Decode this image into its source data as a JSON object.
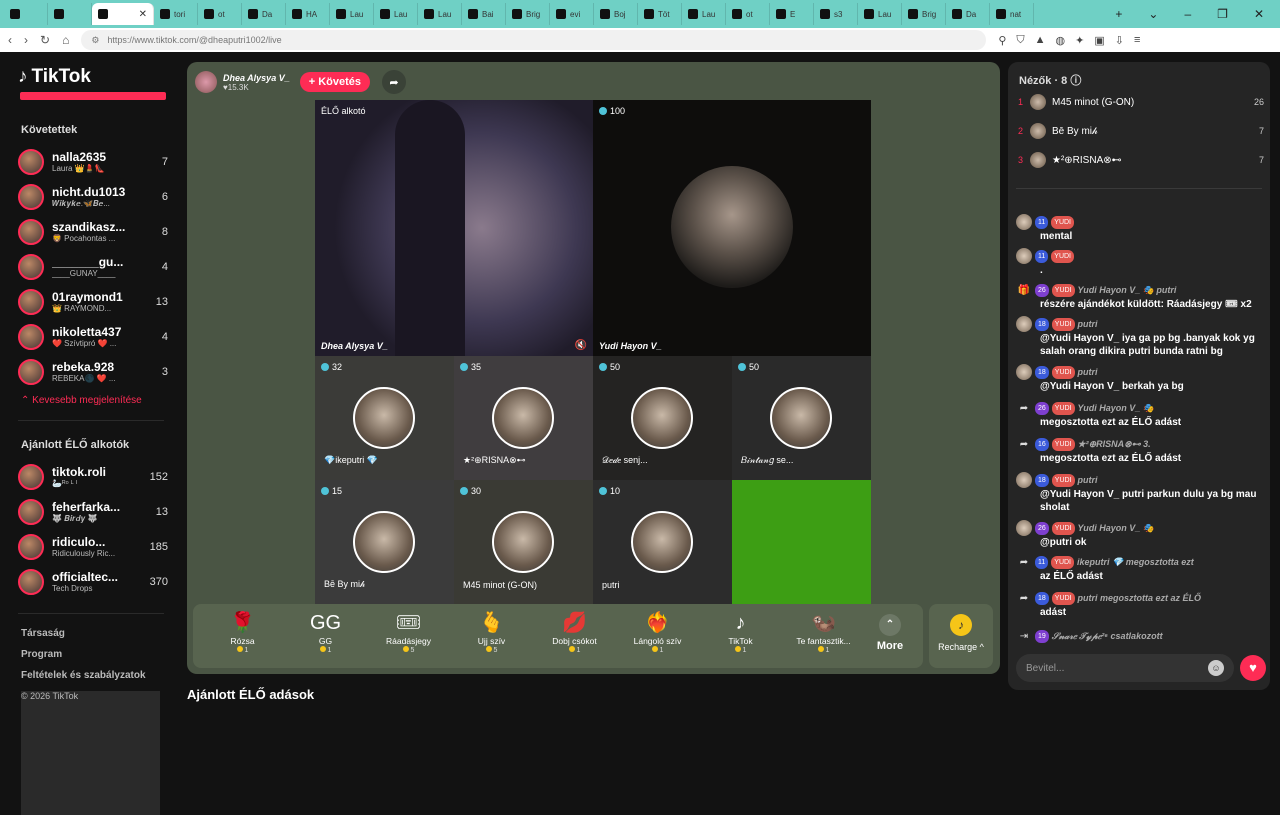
{
  "tabs": [
    "tori",
    "ot",
    "Da",
    "HA",
    "Lau",
    "Lau",
    "Lau",
    "Bai",
    "Brig",
    "evi",
    "Boj",
    "Töt",
    "Lau",
    "ot",
    "E",
    "s3",
    "Lau",
    "Brig",
    "Da",
    "nat"
  ],
  "browser": {
    "url": "https://www.tiktok.com/@dheaputri1002/live"
  },
  "sidebar": {
    "logo": "TikTok",
    "following_title": "Követettek",
    "following": [
      {
        "name": "nalla2635",
        "sub": "Laura 👑💄👠",
        "count": "7"
      },
      {
        "name": "nicht.du1013",
        "sub": "𝑾𝒊𝒌𝒚𝒌𝒆.🦋𝑩𝒆...",
        "count": "6"
      },
      {
        "name": "szandikasz...",
        "sub": "🦁 Pocahontas ...",
        "count": "8"
      },
      {
        "name": "_______gu...",
        "sub": "____GUNAY____",
        "count": "4"
      },
      {
        "name": "01raymond1",
        "sub": "👑 RAYMOND...",
        "count": "13"
      },
      {
        "name": "nikoletta437",
        "sub": "❤️ Szívtipró ❤️ ...",
        "count": "4"
      },
      {
        "name": "rebeka.928",
        "sub": "REBEKA🌑 ❤️ ...",
        "count": "3"
      }
    ],
    "less_label": "Kevesebb megjelenítése",
    "recommended_title": "Ajánlott ÉLŐ alkotók",
    "recommended": [
      {
        "name": "tiktok.roli",
        "sub": "🦢ᴿᵒ ᴸ ᴵ",
        "count": "152"
      },
      {
        "name": "feherfarka...",
        "sub": "🐺 𝑩𝒊𝒓𝒅𝒚 🐺",
        "count": "13"
      },
      {
        "name": "ridiculo...",
        "sub": "Ridiculously Ric...",
        "count": "185"
      },
      {
        "name": "officialtec...",
        "sub": "Tech Drops",
        "count": "370"
      }
    ],
    "footer": [
      "Társaság",
      "Program",
      "Feltételek és szabályzatok"
    ],
    "copyright": "© 2026 TikTok"
  },
  "live": {
    "host_name": "Dhea Alysya V_",
    "host_likes": "♥15.3K",
    "follow_label": "+ Követés",
    "big_cells": [
      {
        "tag": "ÉLŐ alkotó",
        "name": "Dhea Alysya V_"
      },
      {
        "tag": "100",
        "name": "Yudi Hayon V_"
      }
    ],
    "small_cells": [
      {
        "count": "32",
        "name": "💎ikeputri 💎"
      },
      {
        "count": "35",
        "name": "★²⊕RISNA⊗⊷"
      },
      {
        "count": "50",
        "name": "𝒟𝑒𝒹𝑒 senj..."
      },
      {
        "count": "50",
        "name": "𝐵𝒾𝓃𝓉𝒶𝓃𝑔 se..."
      },
      {
        "count": "15",
        "name": "Bē By mi𝒽"
      },
      {
        "count": "30",
        "name": "M45 minot (G-ON)"
      },
      {
        "count": "10",
        "name": "putri"
      }
    ]
  },
  "gifts": [
    {
      "icon": "🌹",
      "name": "Rózsa",
      "price": "1"
    },
    {
      "icon": "GG",
      "name": "GG",
      "price": "1"
    },
    {
      "icon": "🎟",
      "name": "Ráadásjegy",
      "price": "5"
    },
    {
      "icon": "🫰",
      "name": "Ujj szív",
      "price": "5"
    },
    {
      "icon": "💋",
      "name": "Dobj csókot",
      "price": "1"
    },
    {
      "icon": "❤️‍🔥",
      "name": "Lángoló szív",
      "price": "1"
    },
    {
      "icon": "♪",
      "name": "TikTok",
      "price": "1"
    },
    {
      "icon": "🦦",
      "name": "Te fantasztik...",
      "price": "1"
    }
  ],
  "more_label": "More",
  "recharge_label": "Recharge ^",
  "below_title": "Ajánlott ÉLŐ adások",
  "chat": {
    "viewers_title": "Nézők · 8",
    "viewers": [
      {
        "rank": "1",
        "name": "M45 minot (G-ON)",
        "score": "26"
      },
      {
        "rank": "2",
        "name": "Bē By mi𝒽",
        "score": "7"
      },
      {
        "rank": "3",
        "name": "★²⊕RISNA⊗⊷",
        "score": "7"
      }
    ],
    "messages": [
      {
        "badges": [
          "11",
          "YUDI"
        ],
        "user": "",
        "text": "mental"
      },
      {
        "badges": [
          "11",
          "YUDI"
        ],
        "user": "",
        "text": "."
      },
      {
        "badges": [
          "26",
          "YUDI"
        ],
        "user": "Yudi Hayon V_ 🎭 putri",
        "text": "részére ajándékot küldött: Ráadásjegy 🎟 x2"
      },
      {
        "badges": [
          "18",
          "YUDI"
        ],
        "user": "putri",
        "text": "@Yudi Hayon V_ iya ga pp bg .banyak kok yg salah orang dikira putri bunda ratni bg"
      },
      {
        "badges": [
          "18",
          "YUDI"
        ],
        "user": "putri",
        "text": "@Yudi Hayon V_ berkah ya bg"
      },
      {
        "badges": [
          "26",
          "YUDI"
        ],
        "user": "Yudi Hayon V_ 🎭",
        "text": "megosztotta ezt az ÉLŐ adást"
      },
      {
        "badges": [
          "16",
          "YUDI"
        ],
        "user": "★²⊕RISNA⊗⊷ 3.",
        "text": "megosztotta ezt az ÉLŐ adást"
      },
      {
        "badges": [
          "18",
          "YUDI"
        ],
        "user": "putri",
        "text": "@Yudi Hayon V_ putri parkun dulu ya bg mau sholat"
      },
      {
        "badges": [
          "26",
          "YUDI"
        ],
        "user": "Yudi Hayon V_ 🎭",
        "text": "@putri ok"
      },
      {
        "badges": [
          "11",
          "YUDI"
        ],
        "user": "ikeputri 💎 megosztotta ezt",
        "text": "az ÉLŐ adást"
      },
      {
        "badges": [
          "18",
          "YUDI"
        ],
        "user": "putri megosztotta ezt az ÉLŐ",
        "text": "adást"
      },
      {
        "badges": [
          "19"
        ],
        "user": "𝒮𝓃𝒶𝓇𝑒 𝒯𝓎𝓅𝑒²⁶ csatlakozott",
        "text": ""
      }
    ],
    "input_placeholder": "Bevitel..."
  }
}
